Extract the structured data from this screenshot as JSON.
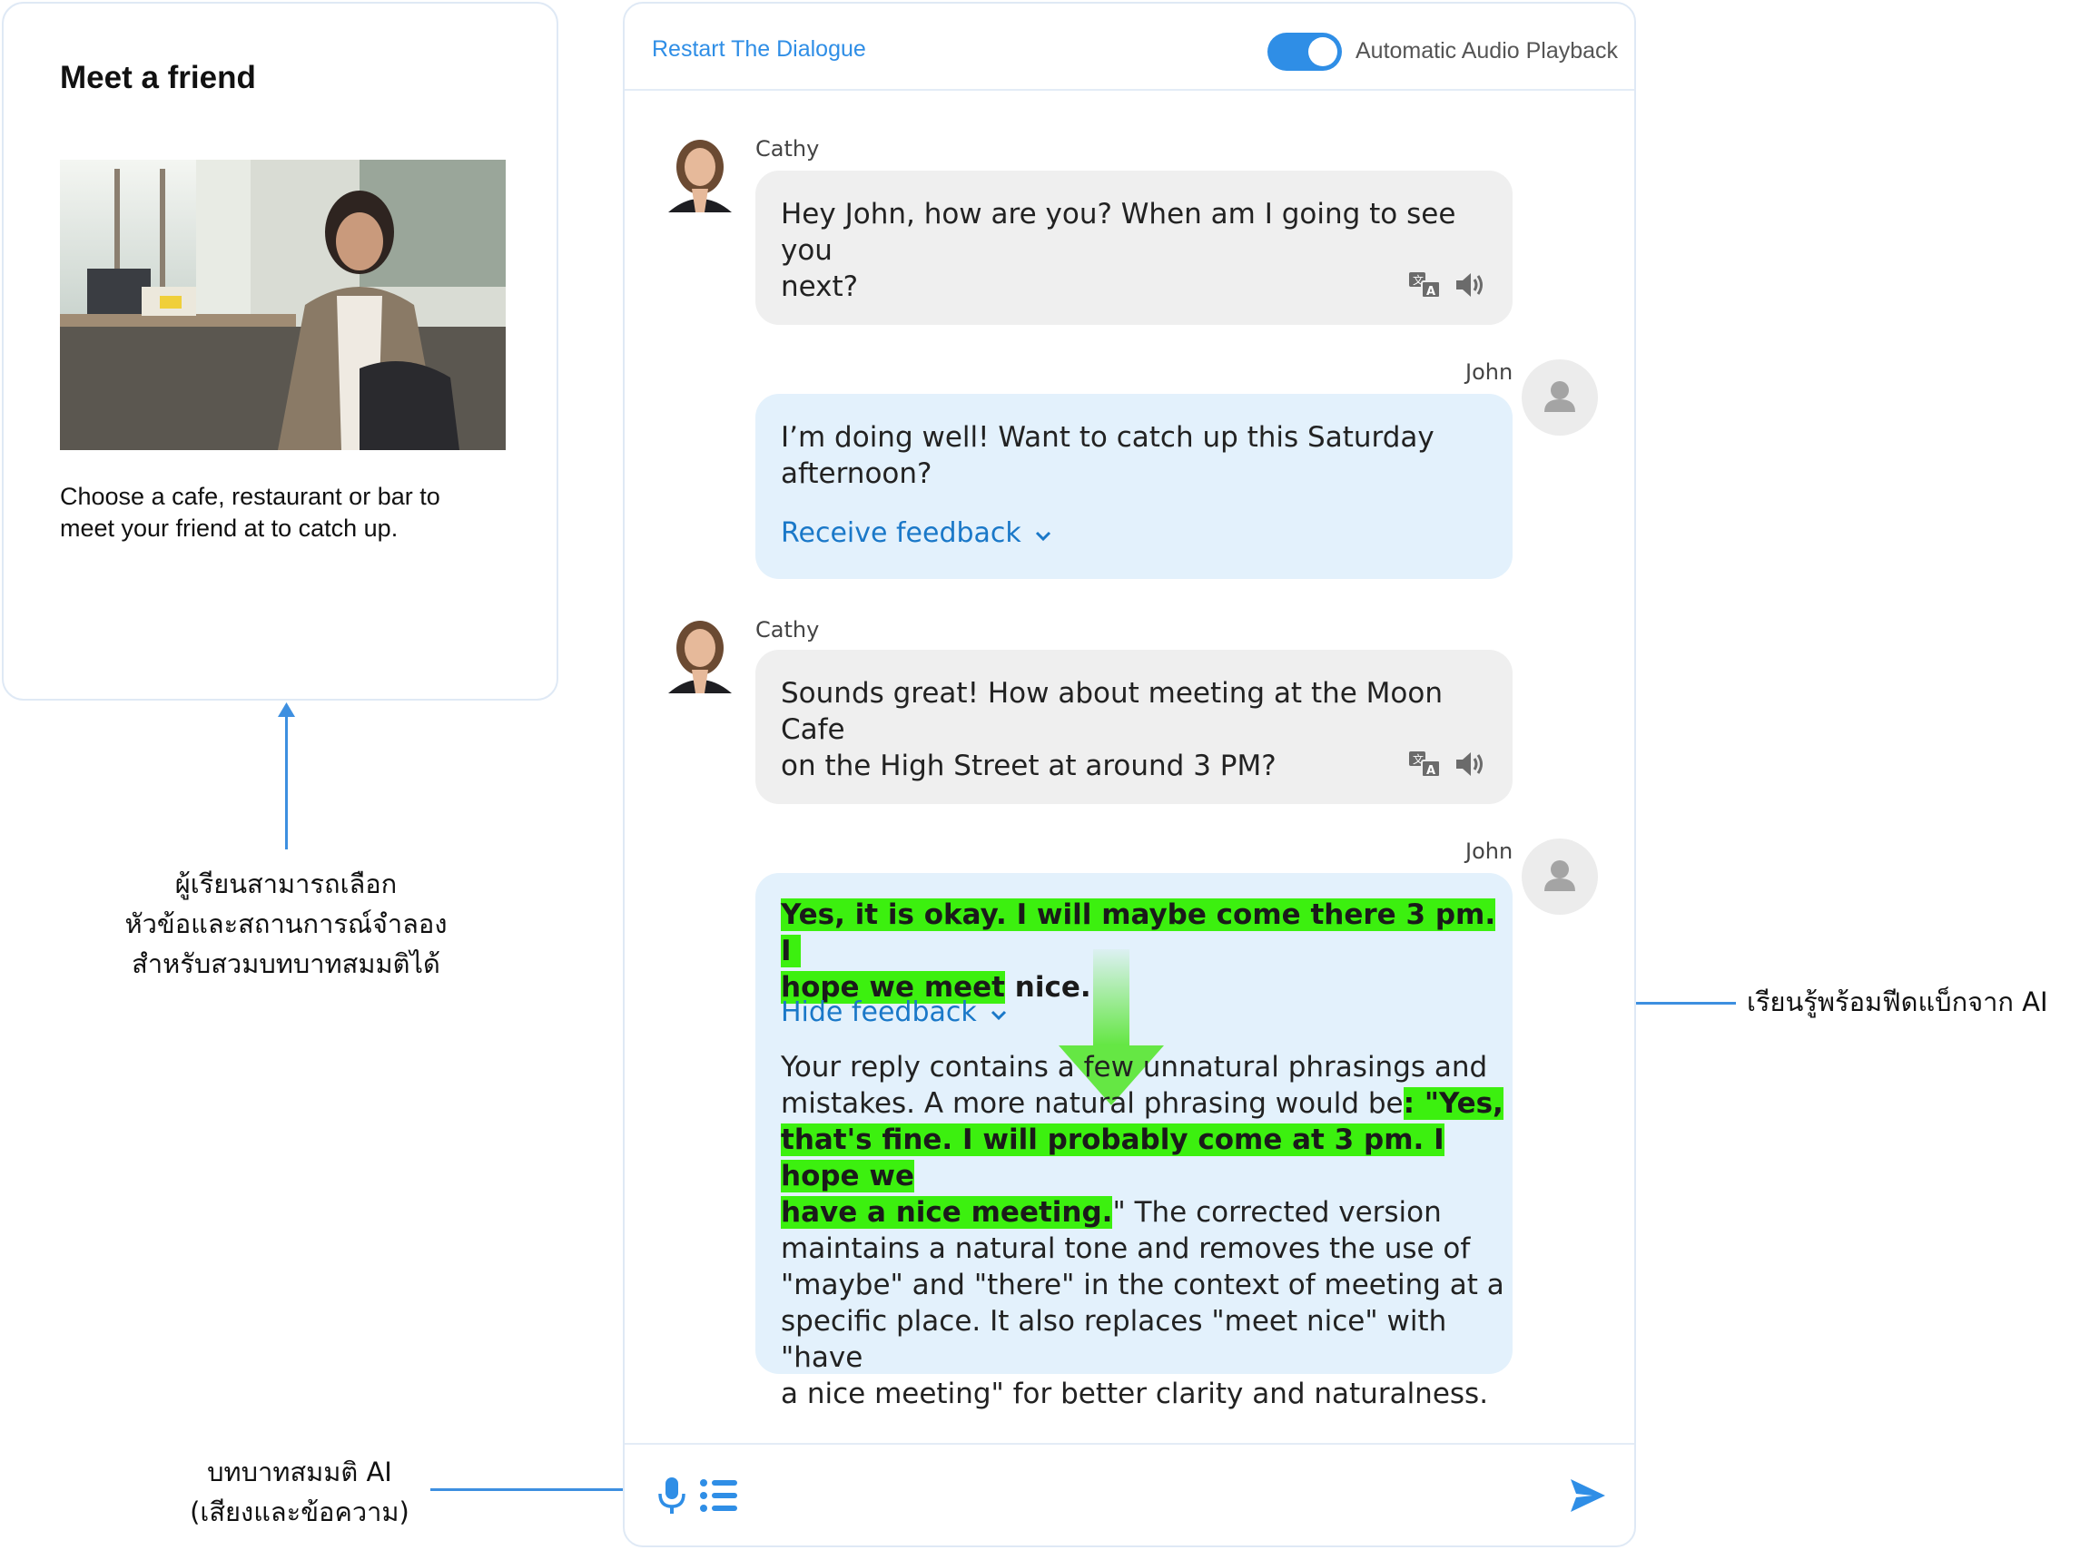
{
  "scenario": {
    "title": "Meet a friend",
    "description": "Choose a cafe, restaurant or bar to meet your friend at to catch up."
  },
  "annotations": {
    "scenario": [
      "ผู้เรียนสามารถเลือก",
      "หัวข้อและสถานการณ์จำลอง",
      "สำหรับสวมบทบาทสมมติได้"
    ],
    "feedback": "เรียนรู้พร้อมฟีดแบ็กจาก AI",
    "roleplay": [
      "บทบาทสมมติ AI",
      "(เสียงและข้อความ)"
    ]
  },
  "header": {
    "restart_label": "Restart The Dialogue",
    "autoplay_label": "Automatic Audio Playback",
    "autoplay_on": true
  },
  "messages": [
    {
      "speaker": "Cathy",
      "lines": [
        "Hey John, how are you? When am I going to see you",
        "next?"
      ]
    },
    {
      "speaker": "John",
      "lines": [
        "I’m doing well! Want to catch up this Saturday",
        "afternoon?"
      ],
      "feedback_label": "Receive feedback"
    },
    {
      "speaker": "Cathy",
      "lines": [
        "Sounds great! How about meeting at the Moon Cafe",
        "on the High Street at around 3 PM?"
      ]
    },
    {
      "speaker": "John",
      "original_line1": "Yes, it is okay. I will maybe come there 3 pm. I",
      "original_line2_hl": "hope we meet",
      "original_line2_rest": " nice.",
      "feedback_label": "Hide feedback",
      "feedback": {
        "l1": "Your reply contains a few unnatural phrasings and",
        "l2_pre": "mistakes. A more natural phrasing would be",
        "l2_hl": ": \"Yes,",
        "l3_hl": "that's fine. I will probably come at 3 pm. I hope we",
        "l4_hl": "have a nice meeting.",
        "l4_rest": "\" The corrected version",
        "l5": "maintains a natural tone and removes the use of",
        "l6": "\"maybe\" and \"there\" in the context of meeting at a",
        "l7": "specific place. It also replaces \"meet nice\" with \"have",
        "l8": "a nice meeting\" for better clarity and naturalness."
      }
    }
  ],
  "icons": [
    "translate-icon",
    "speaker-icon",
    "user-icon",
    "microphone-icon",
    "list-icon",
    "send-icon",
    "chevron-down-icon"
  ],
  "colors": {
    "accent": "#2f8ee6",
    "link": "#1a78c8",
    "highlight": "#3cf00f",
    "bot_bubble": "#efefef",
    "user_bubble": "#e3f1fc"
  }
}
